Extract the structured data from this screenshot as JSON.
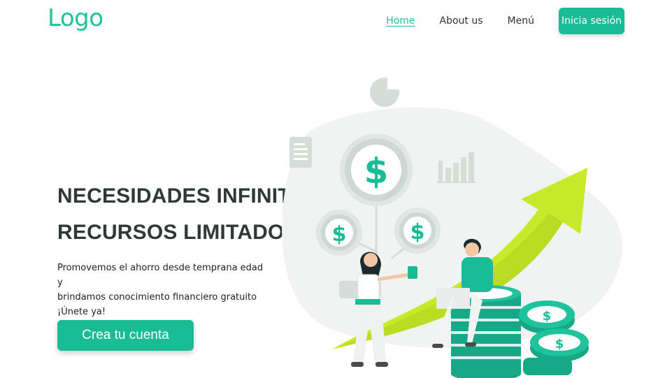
{
  "header": {
    "logo": "Logo",
    "nav": {
      "home": "Home",
      "about": "About us",
      "menu": "Menú"
    },
    "login_label": "Inicia sesión"
  },
  "hero": {
    "headline_line1": "NECESIDADES INFINITAS",
    "headline_line2": "RECURSOS LIMITADOS",
    "desc_line1": "Promovemos el ahorro desde temprana edad y",
    "desc_line2": "brindamos conocimiento financiero gratuito",
    "desc_line3": "¡Únete ya!",
    "cta_label": "Crea tu cuenta"
  },
  "illustration": {
    "coin_symbol": "$",
    "colors": {
      "accent": "#1abc96",
      "arrow": "#c8e82a",
      "blob": "#f0f2f1",
      "icon_gray": "#d5ddd9"
    }
  }
}
